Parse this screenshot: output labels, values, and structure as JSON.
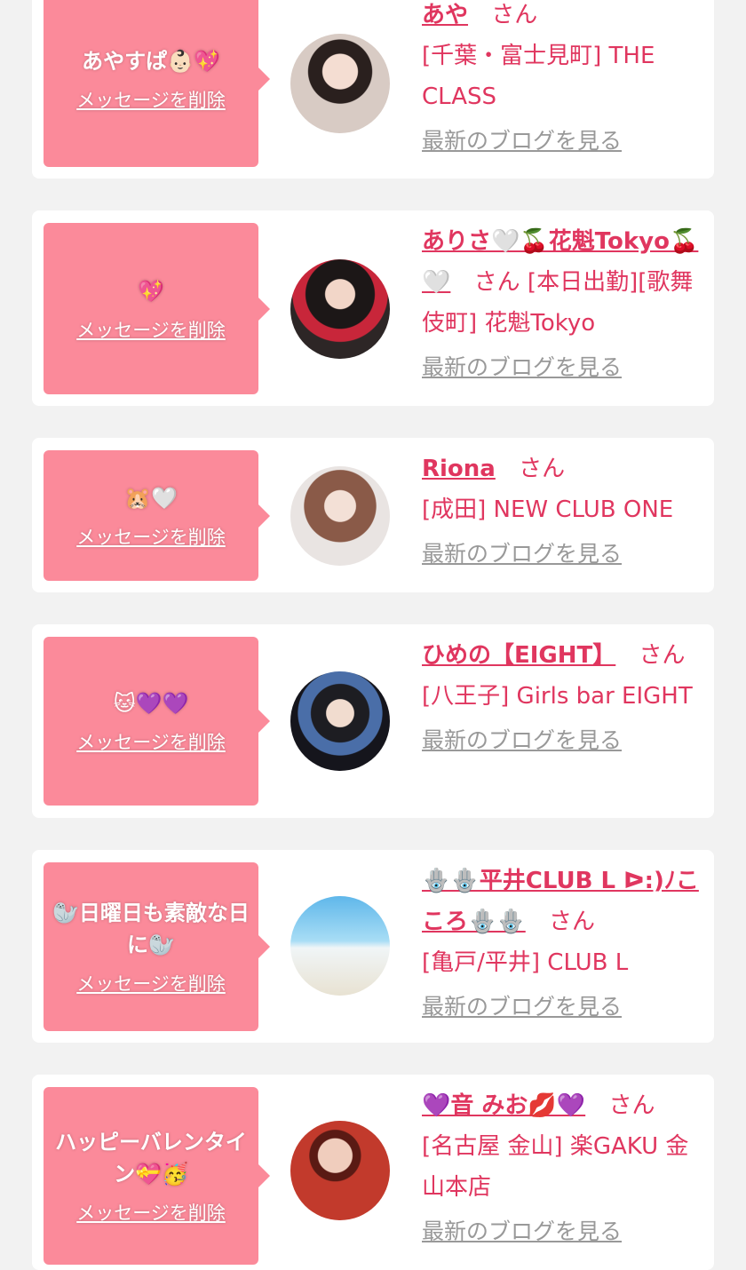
{
  "common": {
    "delete_label": "メッセージを削除",
    "blog_label": "最新のブログを見る",
    "honorific": "さん"
  },
  "items": [
    {
      "message": "あやすぱ👶🏻💖",
      "name": "あや",
      "shop": "[千葉・富士見町] THE CLASS"
    },
    {
      "message": "💖",
      "name": "ありさ🤍🍒花魁Tokyo🍒🤍",
      "shop": "[本日出勤][歌舞伎町] 花魁Tokyo"
    },
    {
      "message": "🐹🤍",
      "name": "Riona",
      "shop": "[成田] NEW CLUB ONE"
    },
    {
      "message": "🐱💜💜",
      "name": "ひめの【EIGHT】",
      "shop": "[八王子] Girls bar EIGHT"
    },
    {
      "message": "🦭日曜日も素敵な日に🦭",
      "name": "🪬🪬平井CLUB L ᐅ:)ﾉこころ🪬🪬",
      "shop": "[亀戸/平井] CLUB L"
    },
    {
      "message": "ハッピーバレンタイン💝🥳",
      "name": "💜音 みお💋💜",
      "shop": "[名古屋 金山] 楽GAKU 金山本店"
    }
  ],
  "avatars": [
    {
      "icon": "avatar-photo",
      "color": "#c9b9b0"
    },
    {
      "icon": "avatar-photo",
      "color": "#3a2b2b"
    },
    {
      "icon": "avatar-photo",
      "color": "#b89285"
    },
    {
      "icon": "avatar-photo",
      "color": "#252733"
    },
    {
      "icon": "avatar-photo",
      "color": "#6ec4ea"
    },
    {
      "icon": "avatar-photo",
      "color": "#b8352b"
    }
  ]
}
